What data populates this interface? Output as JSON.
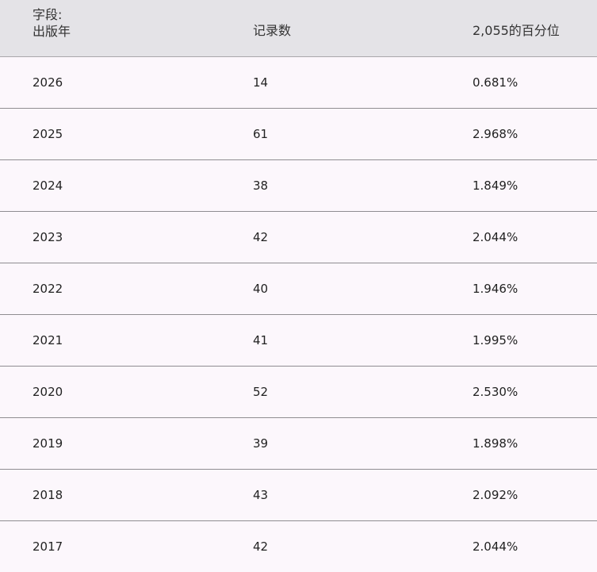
{
  "header": {
    "field_prefix": "字段:",
    "field_name": "出版年",
    "count_label": "记录数",
    "percent_label": "2,055的百分位"
  },
  "rows": [
    {
      "year": "2026",
      "count": "14",
      "percent": "0.681%"
    },
    {
      "year": "2025",
      "count": "61",
      "percent": "2.968%"
    },
    {
      "year": "2024",
      "count": "38",
      "percent": "1.849%"
    },
    {
      "year": "2023",
      "count": "42",
      "percent": "2.044%"
    },
    {
      "year": "2022",
      "count": "40",
      "percent": "1.946%"
    },
    {
      "year": "2021",
      "count": "41",
      "percent": "1.995%"
    },
    {
      "year": "2020",
      "count": "52",
      "percent": "2.530%"
    },
    {
      "year": "2019",
      "count": "39",
      "percent": "1.898%"
    },
    {
      "year": "2018",
      "count": "43",
      "percent": "2.092%"
    },
    {
      "year": "2017",
      "count": "42",
      "percent": "2.044%"
    }
  ]
}
